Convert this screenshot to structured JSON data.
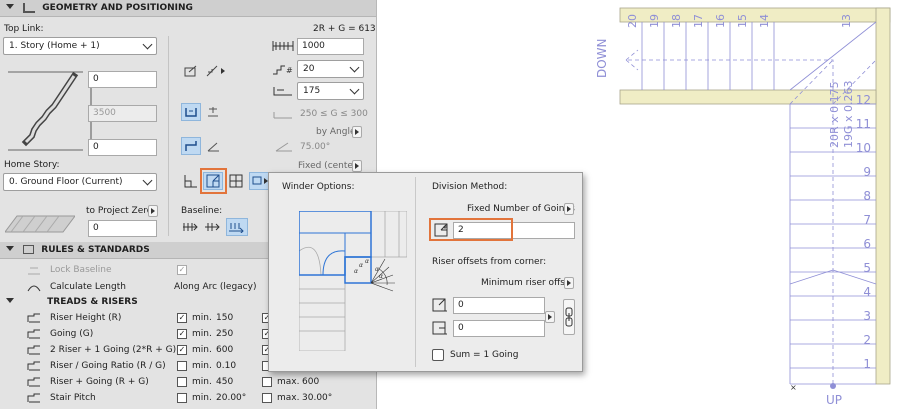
{
  "geometry": {
    "title": "GEOMETRY AND POSITIONING",
    "top_link_label": "Top Link:",
    "top_link_value": "1. Story (Home + 1)",
    "formula": "2R + G = 613",
    "top_offset": "0",
    "height": "3500",
    "bottom_offset": "0",
    "home_story_label": "Home Story:",
    "home_story_value": "0. Ground Floor (Current)",
    "project_zero_label": "to Project Zero",
    "project_zero_value": "0",
    "width_value": "1000",
    "risers_value": "20",
    "riser_height_value": "175",
    "going_range": "250 ≤ G ≤ 300",
    "by_angle": "by Angle",
    "angle_value": "75.00°",
    "fixed_center": "Fixed (center)",
    "baseline_label": "Baseline:"
  },
  "popup": {
    "winder_options": "Winder Options:",
    "division_method": "Division Method:",
    "division_value": "Fixed Number of Goings",
    "goings_value": "2",
    "riser_offsets": "Riser offsets from corner:",
    "offset_method": "Minimum riser offset",
    "offset1": "0",
    "offset2": "0",
    "sum_label": "Sum = 1 Going",
    "angle_marks": [
      "α",
      "α",
      "α",
      "α",
      "α"
    ]
  },
  "rules": {
    "title": "RULES & STANDARDS",
    "lock_baseline": "Lock Baseline",
    "calc_length": "Calculate Length",
    "calc_length_value": "Along Arc (legacy)",
    "treads_title": "TREADS & RISERS",
    "rows": [
      {
        "label": "Riser Height (R)",
        "min_checked": true,
        "min_label": "min.",
        "min_value": "150",
        "max_checked": true,
        "max_label": "",
        "max_value": ""
      },
      {
        "label": "Going (G)",
        "min_checked": true,
        "min_label": "min.",
        "min_value": "250",
        "max_checked": true,
        "max_label": "",
        "max_value": ""
      },
      {
        "label": "2 Riser + 1 Going (2*R + G)",
        "min_checked": true,
        "min_label": "min.",
        "min_value": "600",
        "max_checked": true,
        "max_label": "",
        "max_value": ""
      },
      {
        "label": "Riser / Going Ratio (R / G)",
        "min_checked": false,
        "min_label": "min.",
        "min_value": "0.10",
        "max_checked": false,
        "max_label": "",
        "max_value": ""
      },
      {
        "label": "Riser + Going (R + G)",
        "min_checked": false,
        "min_label": "min.",
        "min_value": "450",
        "max_checked": false,
        "max_label": "max.",
        "max_value": "600"
      },
      {
        "label": "Stair Pitch",
        "min_checked": false,
        "min_label": "min.",
        "min_value": "20.00°",
        "max_checked": false,
        "max_label": "max.",
        "max_value": "30.00°"
      }
    ]
  },
  "plan": {
    "down_label": "DOWN",
    "up_label": "UP",
    "top_numbers": [
      "20",
      "19",
      "18",
      "17",
      "16",
      "15",
      "14",
      "13"
    ],
    "right_numbers": [
      "12",
      "11",
      "10",
      "9",
      "8",
      "7",
      "6",
      "5",
      "4",
      "3",
      "2",
      "1"
    ],
    "note1": "20R x 0.175",
    "note2": "19G x 0.263",
    "color": "#8f8fd6",
    "border_color": "#f0edc5"
  },
  "colors": {
    "highlight": "#e2743b",
    "selected": "#bfd9f2"
  }
}
